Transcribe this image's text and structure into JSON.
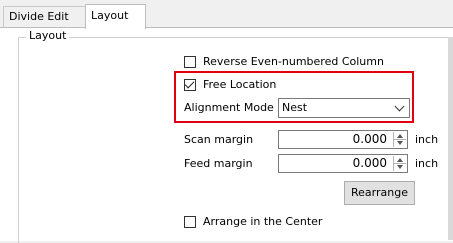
{
  "tabs": [
    {
      "label": "Divide Edit",
      "active": false
    },
    {
      "label": "Layout",
      "active": true
    }
  ],
  "group": {
    "title": "Layout"
  },
  "options": {
    "reverse_even_label": "Reverse Even-numbered Column",
    "reverse_even_checked": false,
    "free_location_label": "Free Location",
    "free_location_checked": true,
    "arrange_center_label": "Arrange in the Center",
    "arrange_center_checked": false
  },
  "alignment": {
    "label": "Alignment Mode",
    "value": "Nest"
  },
  "scan_margin": {
    "label": "Scan margin",
    "value": "0.000",
    "unit": "inch"
  },
  "feed_margin": {
    "label": "Feed margin",
    "value": "0.000",
    "unit": "inch"
  },
  "rearrange": {
    "label": "Rearrange"
  },
  "colors": {
    "highlight": "#e00010",
    "panel_bg": "#ffffff",
    "window_bg": "#f0f0f0"
  }
}
